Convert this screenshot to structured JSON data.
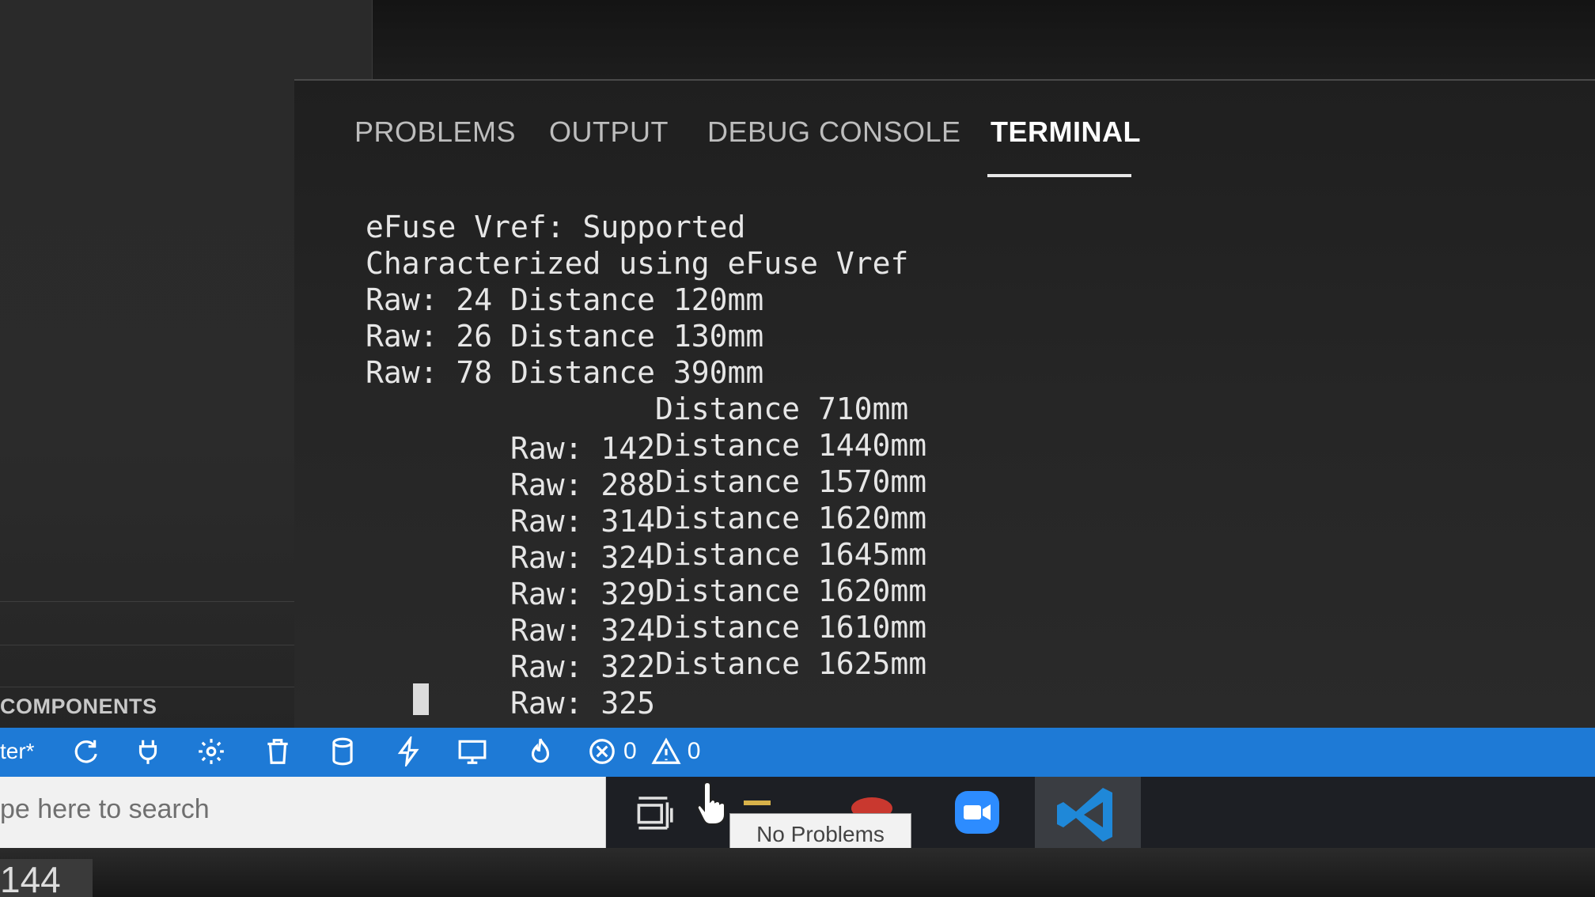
{
  "panel": {
    "tabs": [
      {
        "label": "PROBLEMS"
      },
      {
        "label": "OUTPUT"
      },
      {
        "label": "DEBUG CONSOLE"
      },
      {
        "label": "TERMINAL",
        "active": true
      }
    ]
  },
  "terminal": {
    "lines": [
      "eFuse Vref: Supported",
      "Characterized using eFuse Vref",
      "Raw: 24 Distance 120mm",
      "Raw: 26 Distance 130mm",
      "Raw: 78 Distance 390mm"
    ],
    "readings": [
      {
        "raw": "Raw: 142",
        "distance": "Distance 710mm"
      },
      {
        "raw": "Raw: 288",
        "distance": "Distance 1440mm"
      },
      {
        "raw": "Raw: 314",
        "distance": "Distance 1570mm"
      },
      {
        "raw": "Raw: 324",
        "distance": "Distance 1620mm"
      },
      {
        "raw": "Raw: 329",
        "distance": "Distance 1645mm"
      },
      {
        "raw": "Raw: 324",
        "distance": "Distance 1620mm"
      },
      {
        "raw": "Raw: 322",
        "distance": "Distance 1610mm"
      },
      {
        "raw": "Raw: 325",
        "distance": "Distance 1625mm"
      }
    ]
  },
  "sidebar": {
    "section_title": "COMPONENTS"
  },
  "statusbar": {
    "branch": "ter*",
    "icons": [
      "refresh-icon",
      "plug-icon",
      "gear-icon",
      "trash-icon",
      "database-icon",
      "flash-icon",
      "monitor-icon",
      "flame-icon"
    ],
    "errors": "0",
    "warnings": "0",
    "background": "#1e7ad6"
  },
  "taskbar": {
    "search_placeholder": "pe here to search",
    "tooltip": "No Problems"
  },
  "bezel": {
    "label": "144"
  }
}
